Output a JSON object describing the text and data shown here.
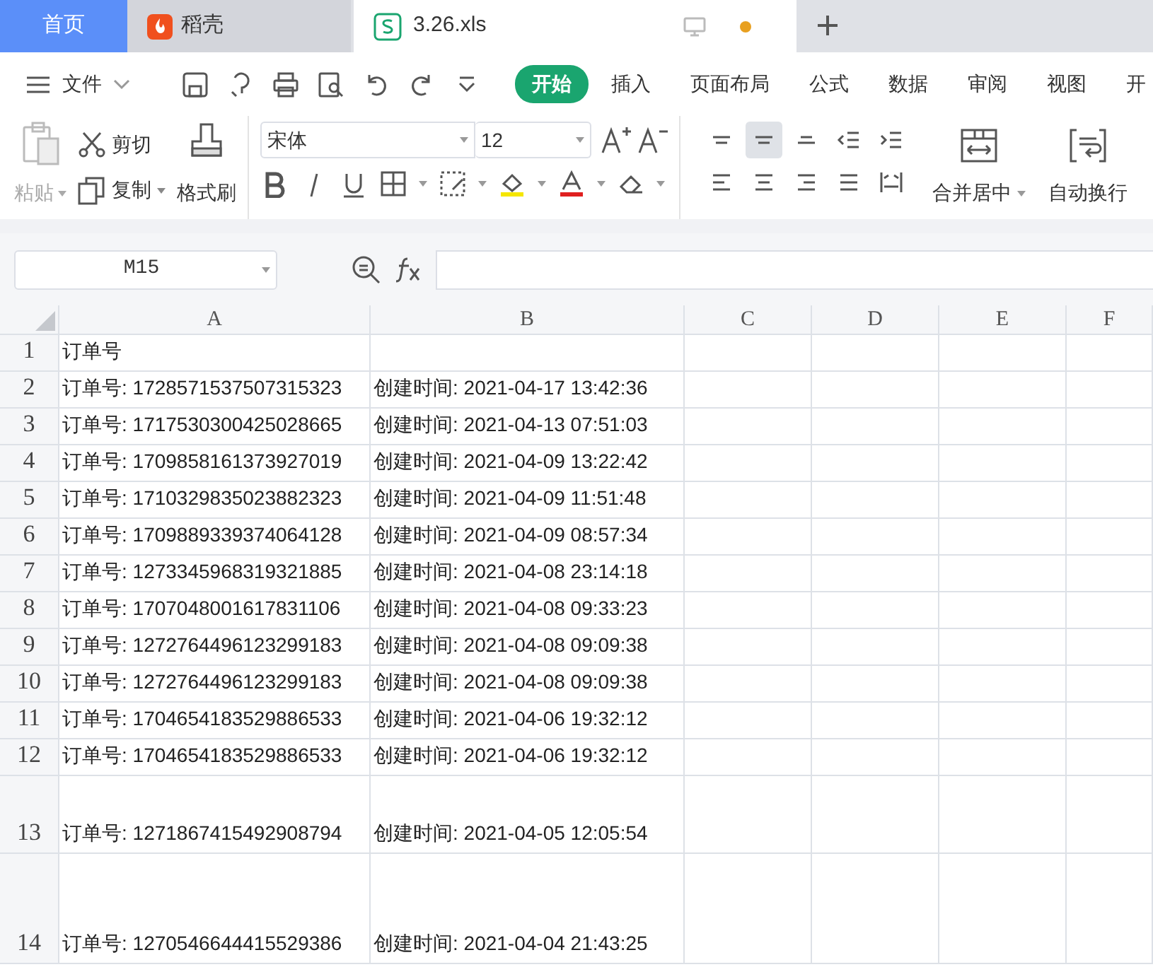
{
  "tabs": [
    {
      "label": "首页",
      "kind": "home",
      "selected": false
    },
    {
      "label": "稻壳",
      "kind": "app",
      "selected": false
    },
    {
      "label": "3.26.xls",
      "kind": "doc",
      "selected": true
    }
  ],
  "menu": {
    "file": "文件",
    "tabs": [
      {
        "label": "开始",
        "selected": true
      },
      {
        "label": "插入",
        "selected": false
      },
      {
        "label": "页面布局",
        "selected": false
      },
      {
        "label": "公式",
        "selected": false
      },
      {
        "label": "数据",
        "selected": false
      },
      {
        "label": "审阅",
        "selected": false
      },
      {
        "label": "视图",
        "selected": false
      },
      {
        "label": "开",
        "selected": false
      }
    ]
  },
  "ribbon": {
    "paste": {
      "label": "粘贴",
      "disabled": true
    },
    "cut": "剪切",
    "copy": "复制",
    "format_painter": "格式刷",
    "font": "宋体",
    "font_size": "12",
    "merge": "合并居中",
    "wrap": "自动换行",
    "align_buttons": [
      {
        "selected": false
      },
      {
        "selected": true
      },
      {
        "selected": false
      },
      {
        "selected": false
      },
      {
        "selected": false
      },
      {
        "selected": false
      },
      {
        "selected": false
      },
      {
        "selected": false
      },
      {
        "selected": false
      },
      {
        "selected": false
      }
    ]
  },
  "name_box": "M15",
  "columns": [
    "A",
    "B",
    "C",
    "D",
    "E",
    "F"
  ],
  "rows": [
    {
      "num": "1",
      "kind": "normal",
      "a": "订单号",
      "b": ""
    },
    {
      "num": "2",
      "kind": "normal",
      "a": "订单号: 1728571537507315323",
      "b": "创建时间: 2021-04-17 13:42:36"
    },
    {
      "num": "3",
      "kind": "normal",
      "a": "订单号: 1717530300425028665",
      "b": "创建时间: 2021-04-13 07:51:03"
    },
    {
      "num": "4",
      "kind": "normal",
      "a": "订单号: 1709858161373927019",
      "b": "创建时间: 2021-04-09 13:22:42"
    },
    {
      "num": "5",
      "kind": "normal",
      "a": "订单号: 1710329835023882323",
      "b": "创建时间: 2021-04-09 11:51:48"
    },
    {
      "num": "6",
      "kind": "normal",
      "a": "订单号: 1709889339374064128",
      "b": "创建时间: 2021-04-09 08:57:34"
    },
    {
      "num": "7",
      "kind": "normal",
      "a": "订单号: 1273345968319321885",
      "b": "创建时间: 2021-04-08 23:14:18"
    },
    {
      "num": "8",
      "kind": "normal",
      "a": "订单号: 1707048001617831106",
      "b": "创建时间: 2021-04-08 09:33:23"
    },
    {
      "num": "9",
      "kind": "normal",
      "a": "订单号: 1272764496123299183",
      "b": "创建时间: 2021-04-08 09:09:38"
    },
    {
      "num": "10",
      "kind": "normal",
      "a": "订单号: 1272764496123299183",
      "b": "创建时间: 2021-04-08 09:09:38"
    },
    {
      "num": "11",
      "kind": "normal",
      "a": "订单号: 1704654183529886533",
      "b": "创建时间: 2021-04-06 19:32:12"
    },
    {
      "num": "12",
      "kind": "normal",
      "a": "订单号: 1704654183529886533",
      "b": "创建时间: 2021-04-06 19:32:12"
    },
    {
      "num": "13",
      "kind": "tall",
      "a": "订单号: 1271867415492908794",
      "b": "创建时间: 2021-04-05 12:05:54"
    },
    {
      "num": "14",
      "kind": "taller",
      "a": "订单号: 1270546644415529386",
      "b": "创建时间: 2021-04-04 21:43:25"
    }
  ]
}
